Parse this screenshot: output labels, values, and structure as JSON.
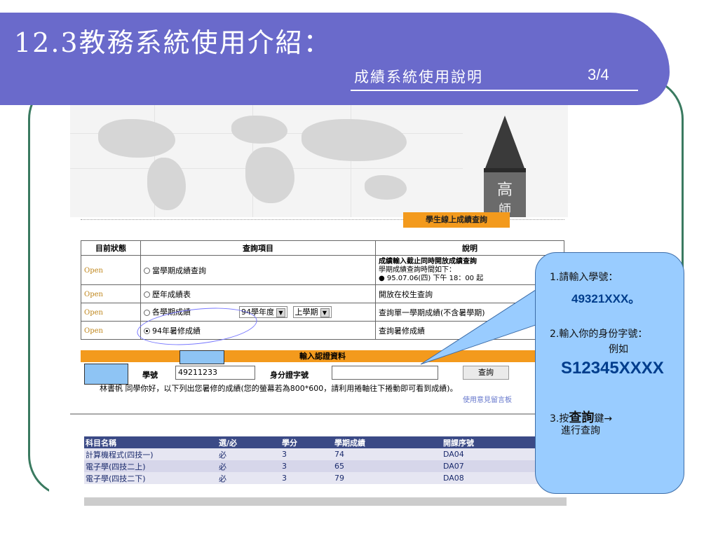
{
  "slide": {
    "title": "12.3教務系統使用介紹：",
    "subtitle": "成績系統使用說明",
    "page": "3/4"
  },
  "banner": {
    "tag": "學生線上成績查詢",
    "tower_char1": "高",
    "tower_char2": "師"
  },
  "table": {
    "headers": [
      "目前狀態",
      "查詢項目",
      "說明"
    ],
    "rows": [
      {
        "status": "Open",
        "item": "當學期成績查詢",
        "desc_bold": "成績輸入截止同時開放成績查詢",
        "desc1": "學期成績查詢時間如下：",
        "desc2": "● 95.07.06(四) 下午 18：00 起"
      },
      {
        "status": "Open",
        "item": "歷年成績表",
        "desc": "開放在校生查詢"
      },
      {
        "status": "Open",
        "item": "各學期成績",
        "year": "94學年度",
        "term": "上學期",
        "desc": "查詢單一學期成績(不含暑學期)"
      },
      {
        "status": "Open",
        "item": "94年暑修成績",
        "desc": "查詢暑修成績"
      }
    ]
  },
  "auth": {
    "bar_title": "輸入認證資料",
    "student_id_label": "學號",
    "student_id_value": "49211233",
    "id_label": "身分證字號",
    "id_value": "",
    "query_button": "查詢"
  },
  "notice": "林書帆 同學你好，以下列出您暑修的成績(您的螢幕若為800*600，請利用捲軸往下捲動即可看到成績)。",
  "feedback_link": "使用意見留言板",
  "grades": {
    "headers": [
      "科目名稱",
      "選/必",
      "學分",
      "學期成績",
      "開課序號"
    ],
    "rows": [
      [
        "計算機程式(四技一)",
        "必",
        "3",
        "74",
        "DA04"
      ],
      [
        "電子學(四技二上)",
        "必",
        "3",
        "65",
        "DA07"
      ],
      [
        "電子學(四技二下)",
        "必",
        "3",
        "79",
        "DA08"
      ]
    ]
  },
  "callout": {
    "step1": "1.請輸入學號：",
    "step1_value": "49321XXX。",
    "step2": "2.輸入你的身份字號：",
    "step2_example": "例如",
    "step2_value": "S12345XXXX",
    "step3_prefix": "3.按",
    "step3_bold": "查詢",
    "step3_suffix": "鍵→",
    "step3_next": "進行查詢"
  },
  "colors": {
    "title_band": "#6a6acb",
    "orange": "#f39a1d",
    "callout": "#99ccff",
    "grade_header": "#3b4a86"
  }
}
